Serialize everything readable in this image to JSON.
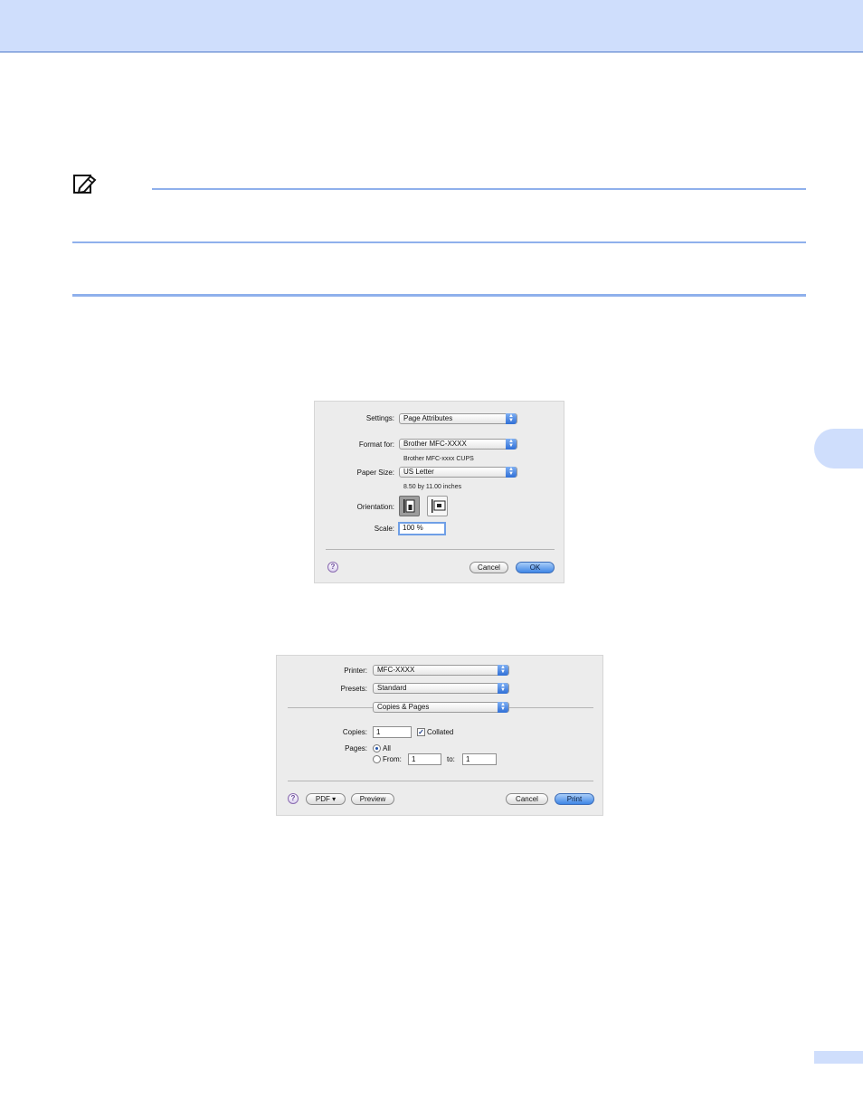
{
  "colors": {
    "accent_band": "#cfdefc",
    "rule": "#8fb0ec"
  },
  "page_setup": {
    "settings_label": "Settings:",
    "settings_value": "Page Attributes",
    "format_label": "Format for:",
    "format_value": "Brother MFC-XXXX",
    "format_sub": "Brother MFC-xxxx CUPS",
    "paper_label": "Paper Size:",
    "paper_value": "US Letter",
    "paper_sub": "8.50 by 11.00 inches",
    "orientation_label": "Orientation:",
    "scale_label": "Scale:",
    "scale_value": "100 %",
    "help": "?",
    "cancel": "Cancel",
    "ok": "OK"
  },
  "print_dialog": {
    "printer_label": "Printer:",
    "printer_value": "MFC-XXXX",
    "presets_label": "Presets:",
    "presets_value": "Standard",
    "panel_value": "Copies & Pages",
    "copies_label": "Copies:",
    "copies_value": "1",
    "collated_label": "Collated",
    "pages_label": "Pages:",
    "all_label": "All",
    "from_label": "From:",
    "from_value": "1",
    "to_label": "to:",
    "to_value": "1",
    "help": "?",
    "pdf": "PDF ▾",
    "preview": "Preview",
    "cancel": "Cancel",
    "print": "Print"
  }
}
